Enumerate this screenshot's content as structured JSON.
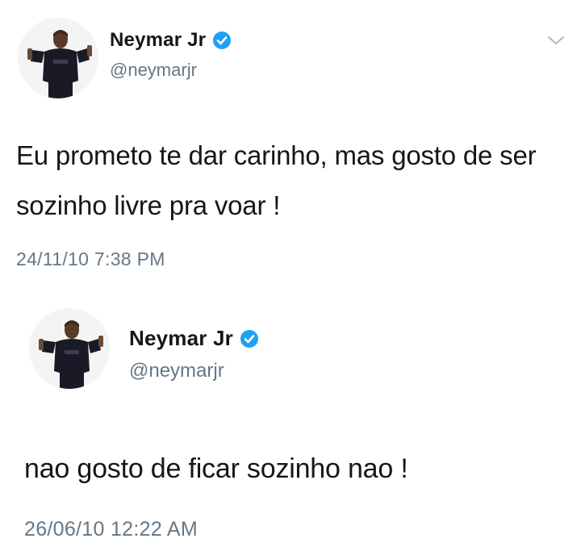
{
  "tweets": [
    {
      "user": {
        "display_name": "Neymar Jr",
        "handle": "@neymarjr",
        "verified": true,
        "avatar_icon": "avatar-photo"
      },
      "text": "Eu prometo te dar carinho, mas gosto de ser sozinho livre pra voar !",
      "timestamp": "24/11/10 7:38 PM",
      "menu_icon": "chevron-down-icon"
    },
    {
      "user": {
        "display_name": "Neymar Jr",
        "handle": "@neymarjr",
        "verified": true,
        "avatar_icon": "avatar-photo"
      },
      "text": "nao gosto de ficar sozinho nao !",
      "timestamp": "26/06/10 12:22 AM"
    }
  ],
  "colors": {
    "verified_badge": "#1da1f2",
    "secondary_text": "#657786",
    "primary_text": "#14171a",
    "background": "#ffffff"
  }
}
